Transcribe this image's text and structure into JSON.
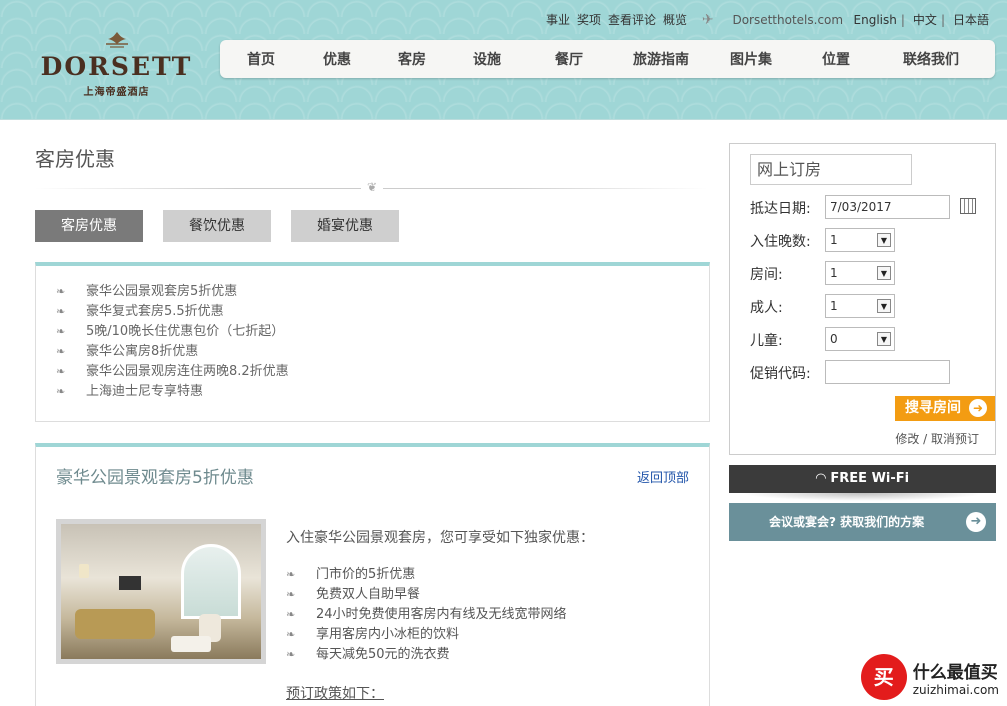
{
  "brand": {
    "name": "DORSETT",
    "subtitle": "上海帝盛酒店"
  },
  "toplinks": {
    "items": [
      "事业",
      "奖项",
      "查看评论",
      "概览"
    ],
    "site": "Dorsetthotels.com"
  },
  "languages": [
    "English",
    "中文",
    "日本語"
  ],
  "nav": [
    "首页",
    "优惠",
    "客房",
    "设施",
    "餐厅",
    "旅游指南",
    "图片集",
    "位置",
    "联络我们"
  ],
  "page": {
    "title": "客房优惠"
  },
  "tabs": [
    {
      "label": "客房优惠",
      "active": true
    },
    {
      "label": "餐饮优惠"
    },
    {
      "label": "婚宴优惠"
    }
  ],
  "offers": [
    "豪华公园景观套房5折优惠",
    "豪华复式套房5.5折优惠",
    "5晚/10晚长住优惠包价（七折起）",
    "豪华公寓房8折优惠",
    "豪华公园景观房连住两晚8.2折优惠",
    "上海迪士尼专享特惠"
  ],
  "detail": {
    "title": "豪华公园景观套房5折优惠",
    "back_to_top": "返回顶部",
    "intro": "入住豪华公园景观套房，您可享受如下独家优惠：",
    "benefits": [
      "门市价的5折优惠",
      "免费双人自助早餐",
      "24小时免费使用客房内有线及无线宽带网络",
      "享用客房内小冰柜的饮料",
      "每天减免50元的洗衣费"
    ],
    "policy_title": "预订政策如下："
  },
  "booking": {
    "title": "网上订房",
    "arrival_label": "抵达日期:",
    "arrival_value": "7/03/2017",
    "nights_label": "入住晚数:",
    "nights_value": "1",
    "rooms_label": "房间:",
    "rooms_value": "1",
    "adults_label": "成人:",
    "adults_value": "1",
    "children_label": "儿童:",
    "children_value": "0",
    "promo_label": "促销代码:",
    "promo_value": "",
    "search_label": "搜寻房间",
    "modify_label": "修改 / 取消预订"
  },
  "wifi": {
    "label": "FREE Wi-Fi"
  },
  "meeting": {
    "label": "会议或宴会? 获取我们的方案"
  },
  "watermark": {
    "badge": "买",
    "text": "什么最值买",
    "url": "zuizhimai.com"
  },
  "colors": {
    "header_bg": "#9fd6d6",
    "accent_orange": "#f39c12",
    "meeting_bg": "#6a909a",
    "link_blue": "#2255aa"
  }
}
